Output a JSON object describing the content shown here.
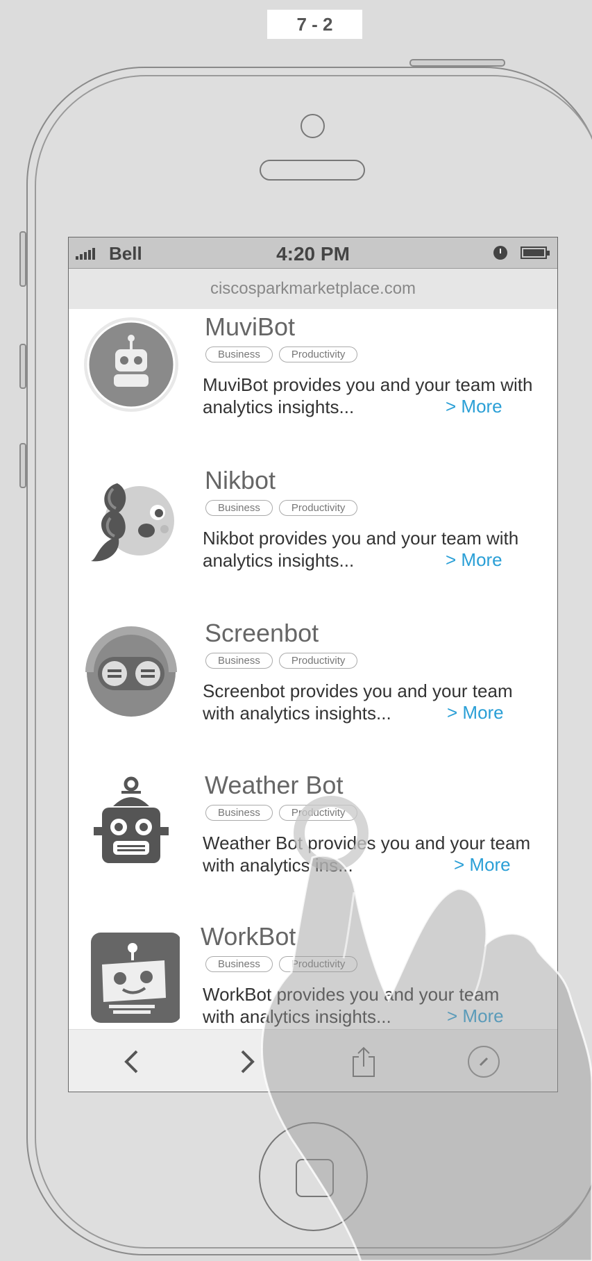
{
  "step_label": "7 - 2",
  "status_bar": {
    "carrier": "Bell",
    "time": "4:20 PM"
  },
  "browser": {
    "url": "ciscosparkmarketplace.com"
  },
  "bots": [
    {
      "name": "MuviBot",
      "icon": "muvibot-robot-icon",
      "tags": [
        "Business",
        "Productivity"
      ],
      "description": "MuviBot provides you and your team with analytics insights...",
      "more": "> More"
    },
    {
      "name": "Nikbot",
      "icon": "nikbot-character-icon",
      "tags": [
        "Business",
        "Productivity"
      ],
      "description": "Nikbot provides you and your team with analytics insights...",
      "more": "> More"
    },
    {
      "name": "Screenbot",
      "icon": "screenbot-face-icon",
      "tags": [
        "Business",
        "Productivity"
      ],
      "description": "Screenbot provides you and your team with analytics insights...",
      "more": "> More"
    },
    {
      "name": "Weather Bot",
      "icon": "weatherbot-robot-icon",
      "tags": [
        "Business",
        "Productivity"
      ],
      "description": "Weather Bot provides you and your team with analytics ins...",
      "more": "> More"
    },
    {
      "name": "WorkBot",
      "icon": "workbot-robot-icon",
      "tags": [
        "Business",
        "Productivity"
      ],
      "description": "WorkBot provides you and your team with analytics insights...",
      "more": "> More"
    }
  ],
  "toolbar": {
    "back_icon": "chevron-left-icon",
    "forward_icon": "chevron-right-icon",
    "share_icon": "share-icon",
    "compass_icon": "compass-icon"
  },
  "colors": {
    "link": "#2a9fd6",
    "status_bar": "#c8c8c8",
    "url_bar": "#e6e6e6"
  }
}
